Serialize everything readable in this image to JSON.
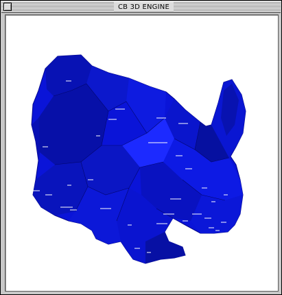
{
  "window": {
    "title": "CB 3D ENGINE"
  },
  "icons": {
    "close": "close-box-icon"
  },
  "colors": {
    "model": "#0a14d8",
    "model_dark": "#05088a",
    "model_light": "#2436ff",
    "background": "#ffffff"
  }
}
